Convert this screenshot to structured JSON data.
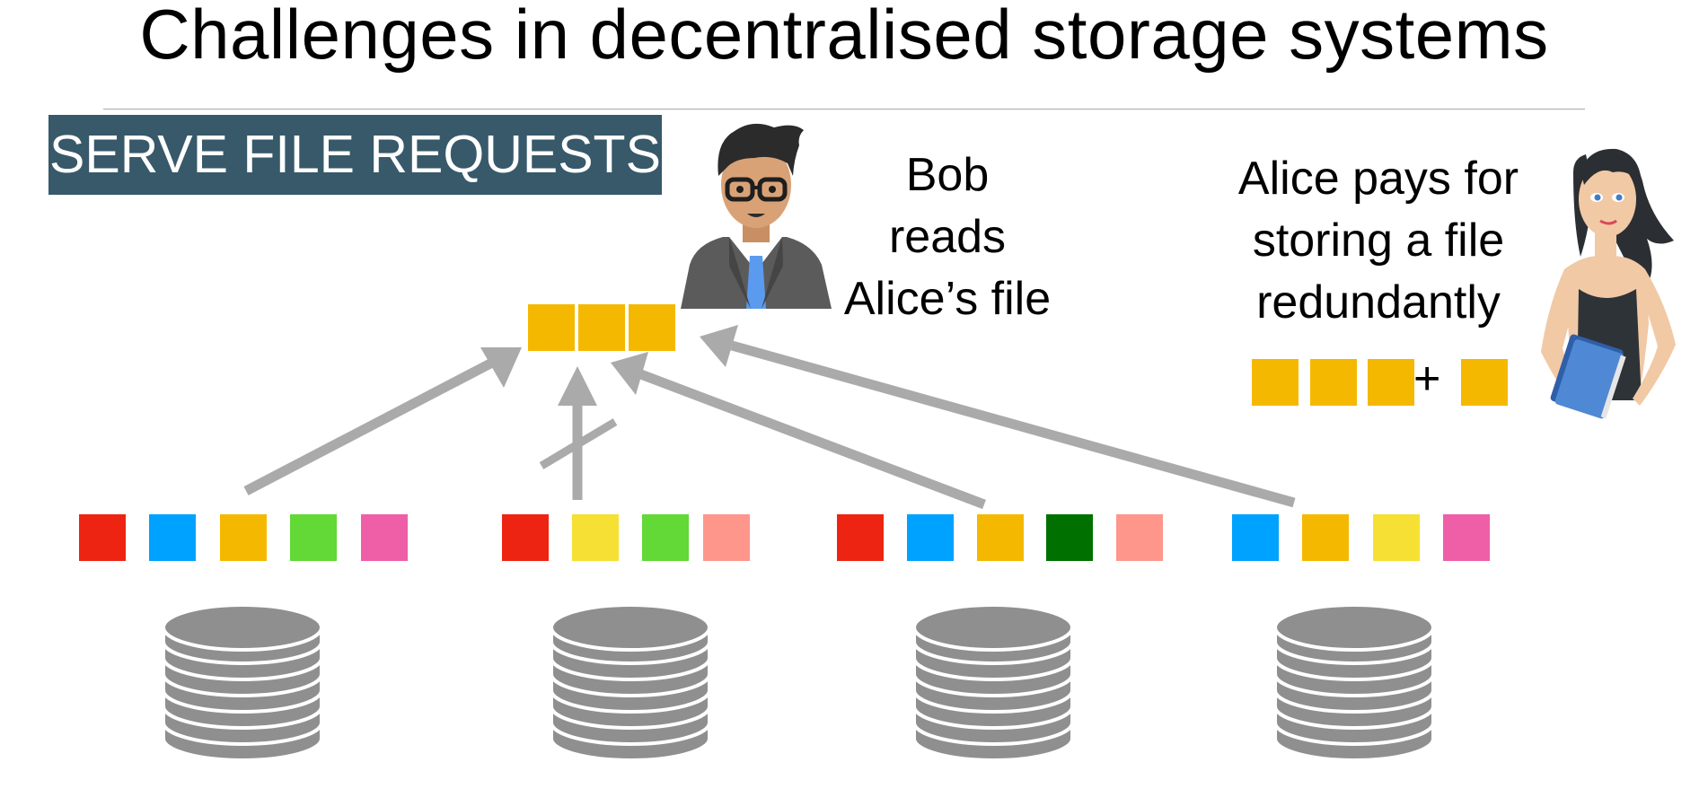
{
  "slide": {
    "title": "Challenges in decentralised storage systems",
    "badge": "SERVE FILE REQUESTS"
  },
  "bob": {
    "caption_lines": [
      "Bob",
      "reads",
      "Alice’s file"
    ]
  },
  "alice": {
    "caption_lines": [
      "Alice pays for",
      "storing a file",
      "redundantly"
    ],
    "plus": "+"
  },
  "colors": {
    "badge_bg": "#37596a",
    "file_chunk": "#f5b800",
    "arrow": "#aaaaaa",
    "disk": "#8f8f8f",
    "red": "#ee2412",
    "blue": "#00a2ff",
    "orange": "#f5b800",
    "green": "#62d936",
    "pink": "#ef5fa7",
    "yellow": "#f6e033",
    "salmon": "#fe968c",
    "darkgreen": "#007100"
  },
  "requested_file": {
    "chunk_colors": [
      "orange",
      "orange",
      "orange"
    ]
  },
  "redundant_file": {
    "chunk_colors": [
      "orange",
      "orange",
      "orange"
    ],
    "parity_chunk_color": "orange"
  },
  "storage_nodes": [
    {
      "chunk_colors": [
        "red",
        "blue",
        "orange",
        "green",
        "pink"
      ],
      "serves_request": true
    },
    {
      "chunk_colors": [
        "red",
        "yellow",
        "green",
        "salmon"
      ],
      "serves_request": false
    },
    {
      "chunk_colors": [
        "red",
        "blue",
        "orange",
        "darkgreen",
        "salmon"
      ],
      "serves_request": true
    },
    {
      "chunk_colors": [
        "blue",
        "orange",
        "yellow",
        "pink"
      ],
      "serves_request": true
    }
  ],
  "icons": {
    "bob": "man-with-glasses-avatar-icon",
    "alice": "woman-holding-folders-avatar-icon",
    "disk": "database-stack-icon",
    "request_arrow": "arrow-icon",
    "blocked_marker": "strike-icon"
  }
}
